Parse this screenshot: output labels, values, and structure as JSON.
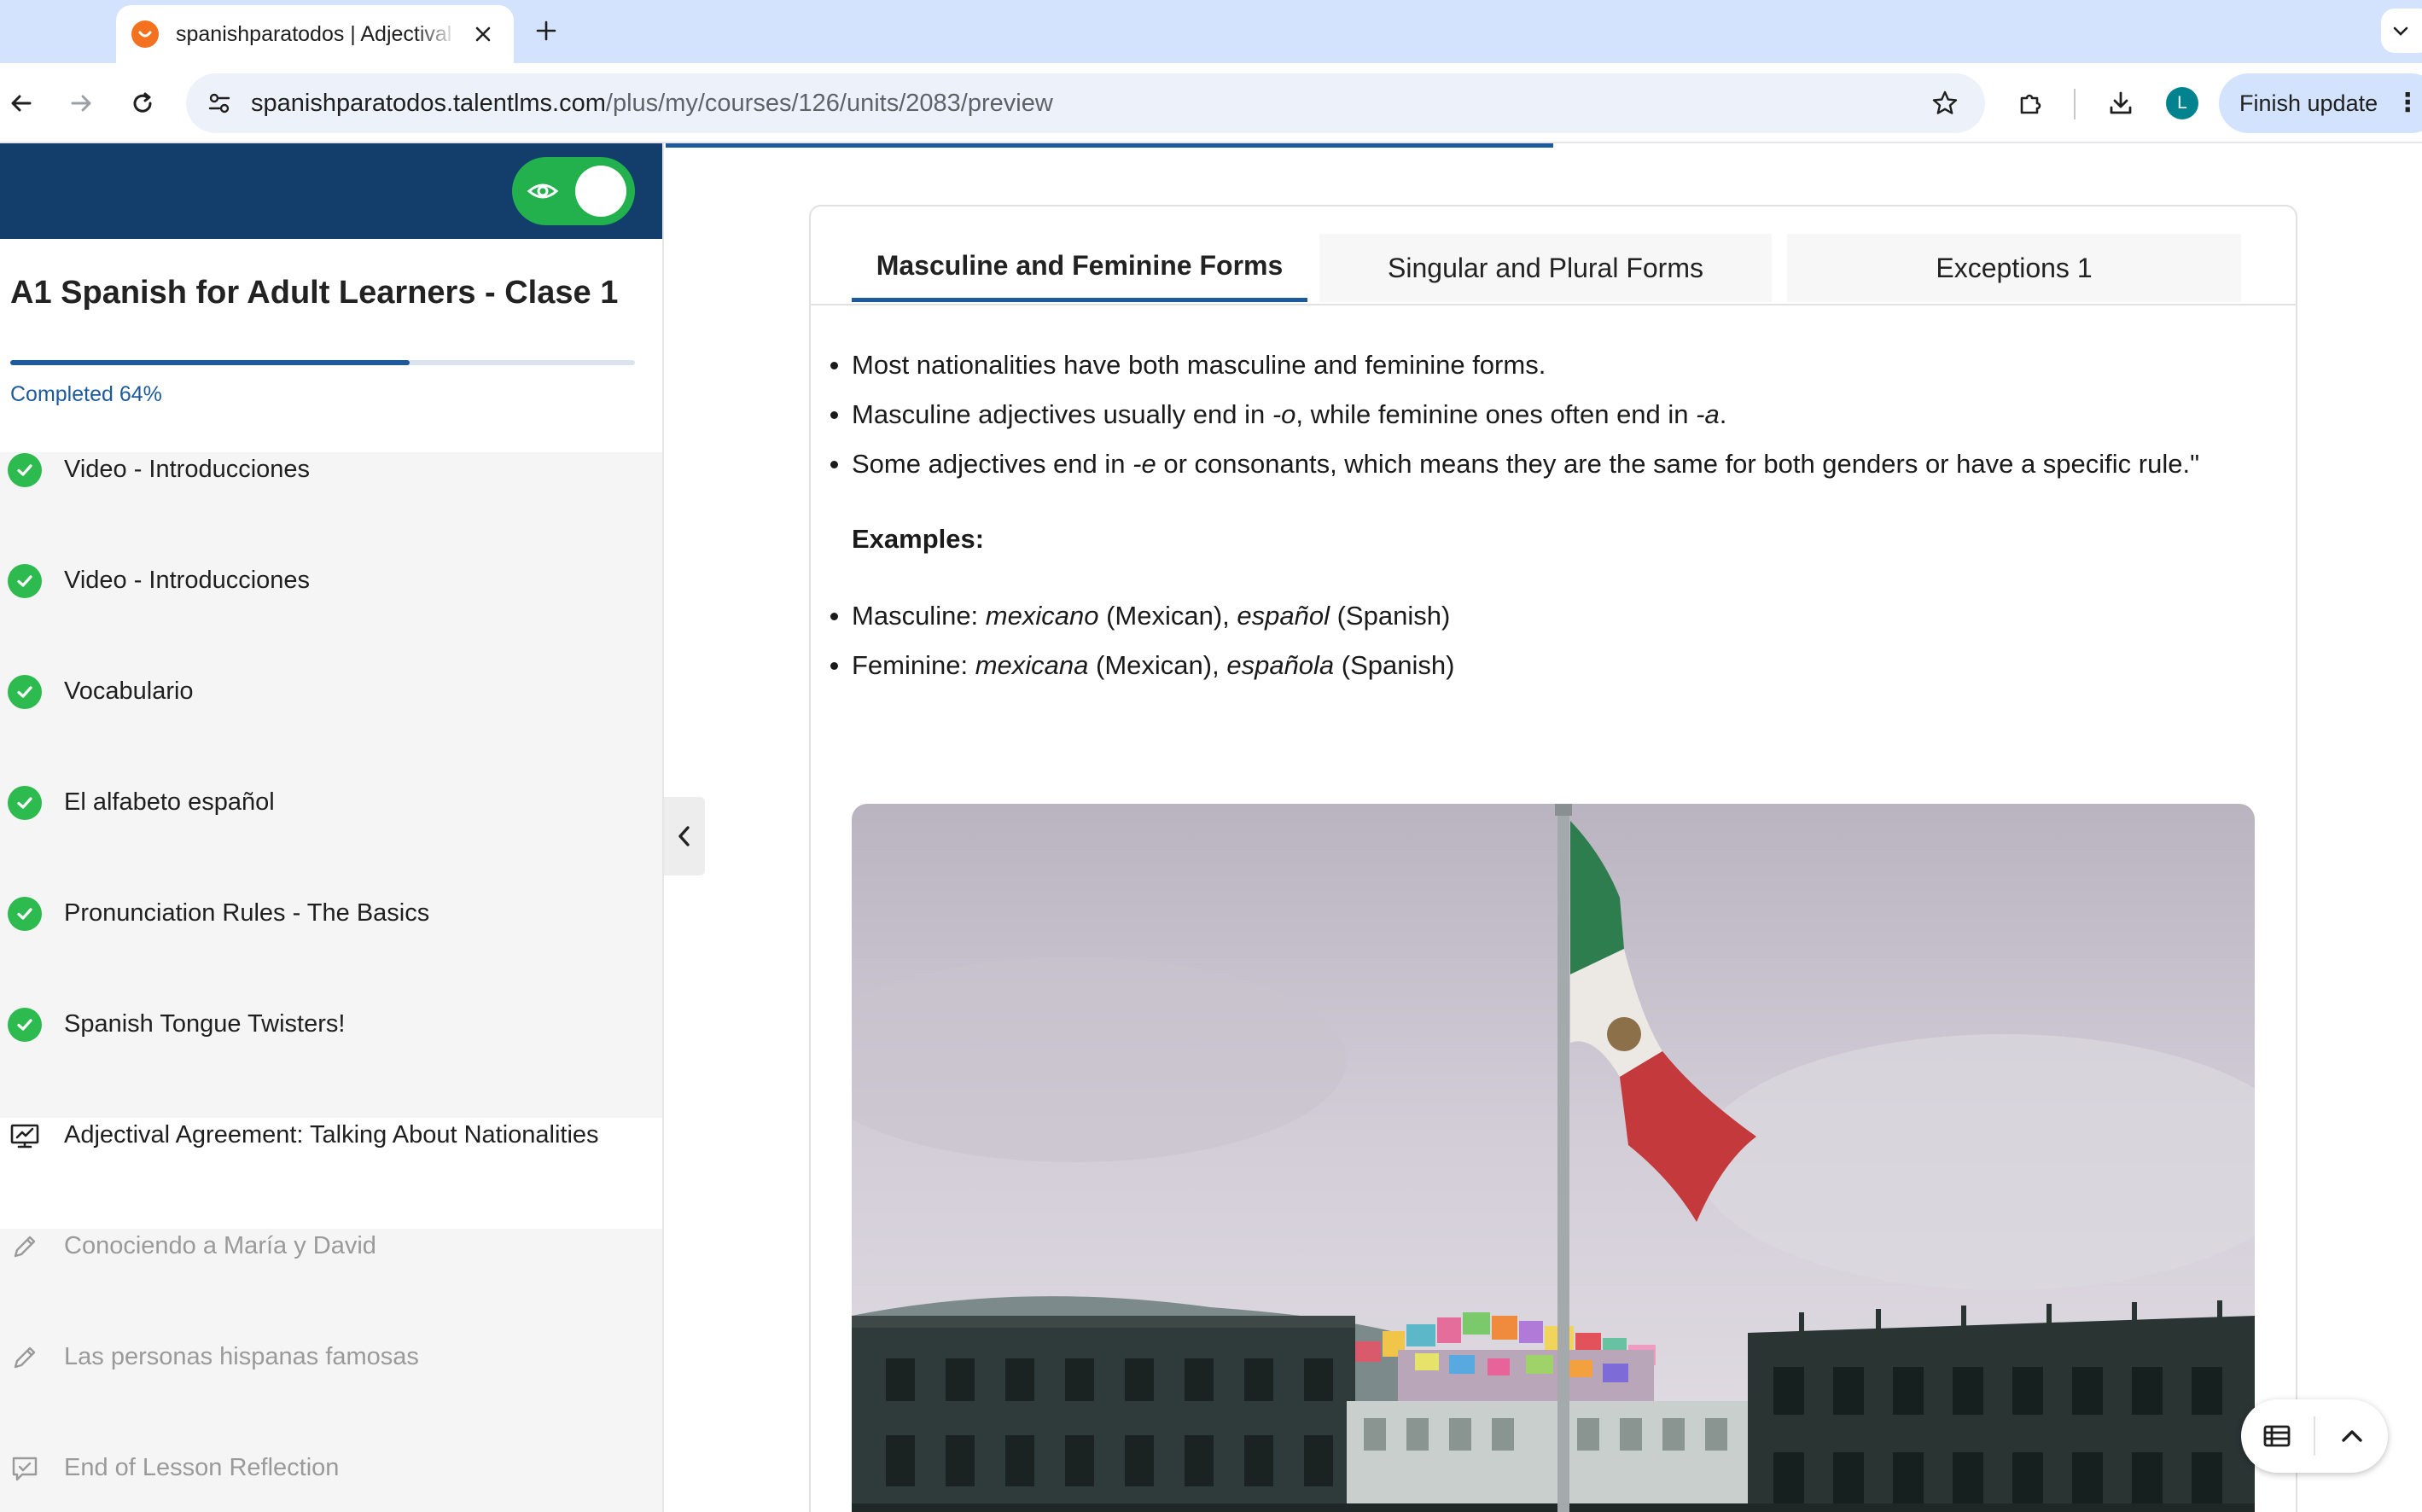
{
  "browser": {
    "tab_title": "spanishparatodos | Adjectival Agreement",
    "url_host": "spanishparatodos.talentlms.com",
    "url_path": "/plus/my/courses/126/units/2083/preview",
    "finish_update_label": "Finish update",
    "avatar_letter": "L",
    "favicon_color": "#f4711f"
  },
  "sidebar": {
    "course_title": "A1 Spanish for Adult Learners - Clase 1",
    "progress_percent": 64,
    "completed_label": "Completed 64%",
    "units": [
      {
        "label": "Video - Introducciones",
        "status": "completed",
        "icon": "check-circle-icon"
      },
      {
        "label": "Video - Introducciones",
        "status": "completed",
        "icon": "check-circle-icon"
      },
      {
        "label": "Vocabulario",
        "status": "completed",
        "icon": "check-circle-icon"
      },
      {
        "label": "El alfabeto español",
        "status": "completed",
        "icon": "check-circle-icon"
      },
      {
        "label": "Pronunciation Rules - The Basics",
        "status": "completed",
        "icon": "check-circle-icon"
      },
      {
        "label": "Spanish Tongue Twisters!",
        "status": "completed",
        "icon": "check-circle-icon"
      },
      {
        "label": "Adjectival Agreement: Talking About Nationalities",
        "status": "active",
        "icon": "presentation-icon"
      },
      {
        "label": "Conociendo a María y David",
        "status": "locked",
        "icon": "pencil-icon"
      },
      {
        "label": "Las personas hispanas famosas",
        "status": "locked",
        "icon": "pencil-icon"
      },
      {
        "label": "End of Lesson Reflection",
        "status": "locked",
        "icon": "reflection-icon"
      }
    ]
  },
  "content": {
    "tabs": [
      "Masculine and Feminine Forms",
      "Singular and Plural Forms",
      "Exceptions 1"
    ],
    "active_tab": 0,
    "bullets": {
      "b1": "Most nationalities have both masculine and feminine forms.",
      "b2_a": "Masculine adjectives usually end in ",
      "b2_b": "-o",
      "b2_c": ", while feminine ones often end in ",
      "b2_d": "-a",
      "b2_e": ".",
      "b3_a": "Some adjectives end in ",
      "b3_b": "-e",
      "b3_c": " or consonants, which means they are the same for both genders or have a specific rule.\""
    },
    "examples_heading": "Examples:",
    "examples": {
      "m_label": "Masculine: ",
      "m_word1": "mexicano",
      "m_gloss1": " (Mexican), ",
      "m_word2": "español",
      "m_gloss2": " (Spanish)",
      "f_label": "Feminine: ",
      "f_word1": "mexicana",
      "f_gloss1": " (Mexican), ",
      "f_word2": "española",
      "f_gloss2": " (Spanish)"
    }
  },
  "colors": {
    "brand_navy": "#133d6b",
    "progress_blue": "#1e5a9b",
    "toggle_green": "#23b14d",
    "check_green": "#2dba4e"
  }
}
